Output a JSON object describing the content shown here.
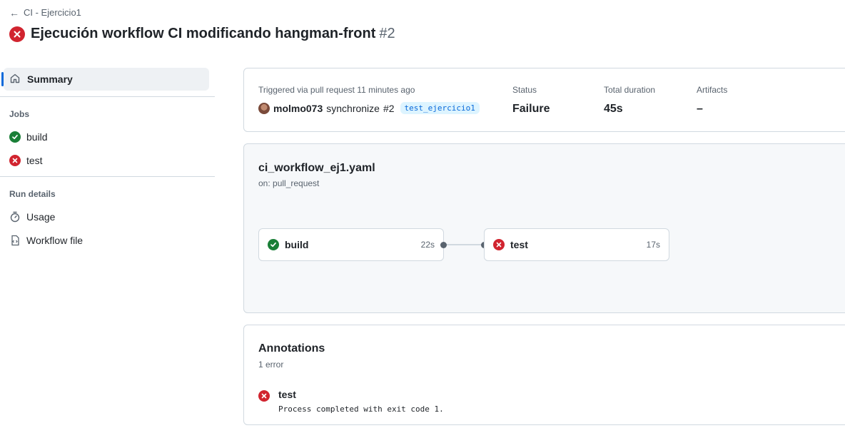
{
  "header": {
    "back_label": "CI - Ejercicio1",
    "title": "Ejecución workflow CI modificando hangman-front",
    "run_number": "#2"
  },
  "sidebar": {
    "summary_label": "Summary",
    "jobs_heading": "Jobs",
    "jobs": [
      {
        "label": "build",
        "status": "success"
      },
      {
        "label": "test",
        "status": "failure"
      }
    ],
    "run_details_heading": "Run details",
    "details": [
      {
        "label": "Usage",
        "icon": "stopwatch-icon"
      },
      {
        "label": "Workflow file",
        "icon": "file-code-icon"
      }
    ]
  },
  "info": {
    "trigger_text": "Triggered via pull request 11 minutes ago",
    "actor": "molmo073",
    "action": "synchronize",
    "pr": "#2",
    "branch": "test_ejercicio1",
    "status_label": "Status",
    "status_value": "Failure",
    "duration_label": "Total duration",
    "duration_value": "45s",
    "artifacts_label": "Artifacts",
    "artifacts_value": "–"
  },
  "graph": {
    "workflow_file": "ci_workflow_ej1.yaml",
    "trigger": "on: pull_request",
    "jobs": [
      {
        "name": "build",
        "duration": "22s",
        "status": "success"
      },
      {
        "name": "test",
        "duration": "17s",
        "status": "failure"
      }
    ]
  },
  "annotations": {
    "title": "Annotations",
    "count": "1 error",
    "items": [
      {
        "job": "test",
        "message": "Process completed with exit code 1."
      }
    ]
  },
  "colors": {
    "success": "#1a7f37",
    "failure": "#d1242f",
    "accent": "#0969da"
  }
}
